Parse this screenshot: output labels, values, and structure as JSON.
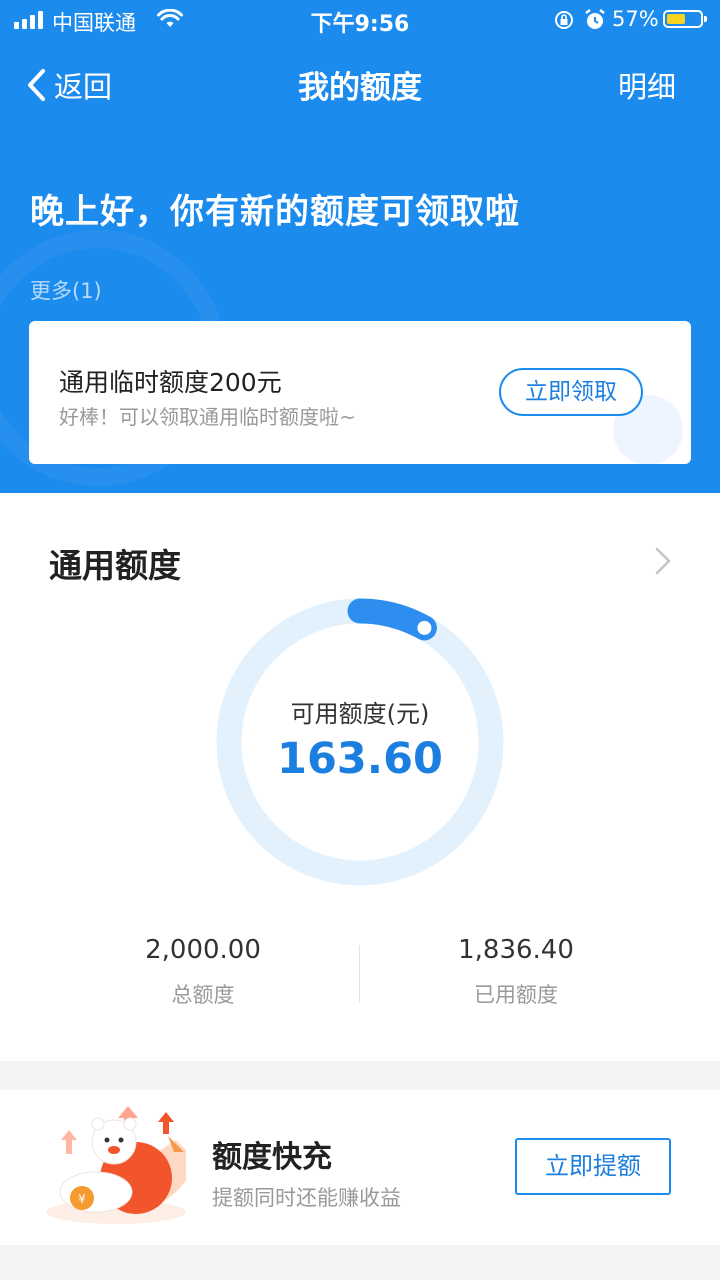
{
  "status_bar": {
    "carrier": "中国联通",
    "time": "下午9:56",
    "battery_percent": "57%",
    "battery_level": 0.57
  },
  "nav": {
    "back_label": "返回",
    "title": "我的额度",
    "detail_label": "明细"
  },
  "banner": {
    "greeting": "晚上好，你有新的额度可领取啦",
    "more_label": "更多(1)",
    "offer": {
      "title": "通用临时额度200元",
      "subtitle": "好棒！可以领取通用临时额度啦~",
      "button_label": "立即领取"
    }
  },
  "credit": {
    "section_title": "通用额度",
    "available_label": "可用额度(元)",
    "available_value": "163.60",
    "available_fraction": 0.0818,
    "total_value": "2,000.00",
    "total_label": "总额度",
    "used_value": "1,836.40",
    "used_label": "已用额度"
  },
  "quick_boost": {
    "title": "额度快充",
    "subtitle": "提额同时还能赚收益",
    "button_label": "立即提额"
  },
  "colors": {
    "primary": "#1c8bee",
    "ring_track": "#e3f1fd",
    "ring_progress": "#2e8ef0"
  }
}
